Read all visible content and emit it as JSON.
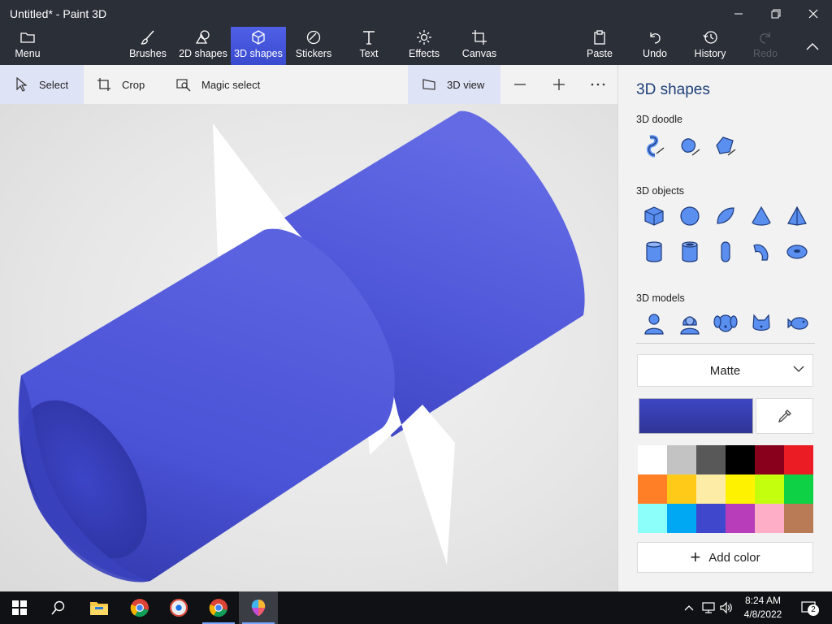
{
  "window": {
    "title": "Untitled* - Paint 3D"
  },
  "ribbon": {
    "menu": "Menu",
    "brushes": "Brushes",
    "shapes2d": "2D shapes",
    "shapes3d": "3D shapes",
    "stickers": "Stickers",
    "text": "Text",
    "effects": "Effects",
    "canvas": "Canvas",
    "paste": "Paste",
    "undo": "Undo",
    "history": "History",
    "redo": "Redo"
  },
  "toolbar": {
    "select": "Select",
    "crop": "Crop",
    "magic_select": "Magic select",
    "view3d": "3D view"
  },
  "panel": {
    "title": "3D shapes",
    "doodle_label": "3D doodle",
    "objects_label": "3D objects",
    "models_label": "3D models",
    "material": "Matte",
    "add_color": "Add color",
    "current_color": "#3d46c4",
    "palette": [
      "#ffffff",
      "#c3c3c3",
      "#585858",
      "#000000",
      "#88001b",
      "#ec1c24",
      "#ff7f27",
      "#ffca18",
      "#fdeca6",
      "#fff200",
      "#c4ff0e",
      "#0ed145",
      "#8cfffb",
      "#00a8f3",
      "#3f48cc",
      "#b83dba",
      "#ffaec8",
      "#b97a56"
    ]
  },
  "taskbar": {
    "time": "8:24 AM",
    "date": "4/8/2022",
    "notifications": "2"
  }
}
